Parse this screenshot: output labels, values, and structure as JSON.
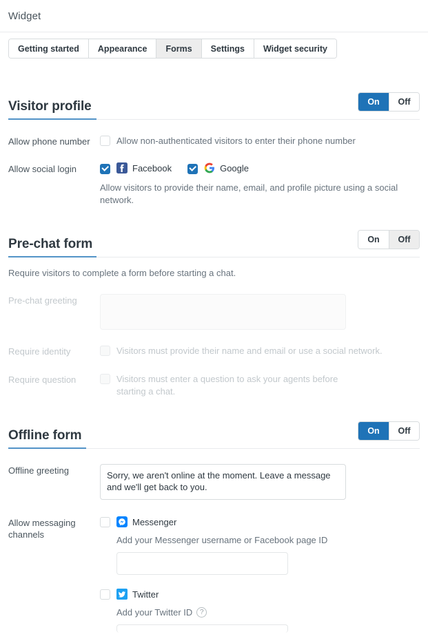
{
  "header": {
    "title": "Widget"
  },
  "tabs": [
    {
      "label": "Getting started",
      "active": false
    },
    {
      "label": "Appearance",
      "active": false
    },
    {
      "label": "Forms",
      "active": true
    },
    {
      "label": "Settings",
      "active": false
    },
    {
      "label": "Widget security",
      "active": false
    }
  ],
  "toggle_labels": {
    "on": "On",
    "off": "Off"
  },
  "visitor_profile": {
    "title": "Visitor profile",
    "state": "On",
    "phone": {
      "label": "Allow phone number",
      "description": "Allow non-authenticated visitors to enter their phone number",
      "checked": false
    },
    "social": {
      "label": "Allow social login",
      "facebook": {
        "label": "Facebook",
        "icon": "facebook-icon",
        "checked": true
      },
      "google": {
        "label": "Google",
        "icon": "google-icon",
        "checked": true
      },
      "description": "Allow visitors to provide their name, email, and profile picture using a social network."
    }
  },
  "prechat_form": {
    "title": "Pre-chat form",
    "state": "Off",
    "description": "Require visitors to complete a form before starting a chat.",
    "greeting": {
      "label": "Pre-chat greeting",
      "value": ""
    },
    "require_identity": {
      "label": "Require identity",
      "description": "Visitors must provide their name and email or use a social network.",
      "checked": false
    },
    "require_question": {
      "label": "Require question",
      "description": "Visitors must enter a question to ask your agents before starting a chat.",
      "checked": false
    }
  },
  "offline_form": {
    "title": "Offline form",
    "state": "On",
    "greeting": {
      "label": "Offline greeting",
      "value": "Sorry, we aren't online at the moment. Leave a message and we'll get back to you."
    },
    "channels": {
      "label": "Allow messaging channels",
      "messenger": {
        "name": "Messenger",
        "icon": "messenger-icon",
        "checked": false,
        "hint": "Add your Messenger username or Facebook page ID",
        "value": ""
      },
      "twitter": {
        "name": "Twitter",
        "icon": "twitter-icon",
        "checked": false,
        "hint": "Add your Twitter ID",
        "help": "?",
        "value": ""
      }
    }
  },
  "colors": {
    "accent": "#1f73b7",
    "underline": "#5293c7",
    "facebook": "#3b5998",
    "twitter": "#1da1f2",
    "messenger": "#0084ff"
  }
}
